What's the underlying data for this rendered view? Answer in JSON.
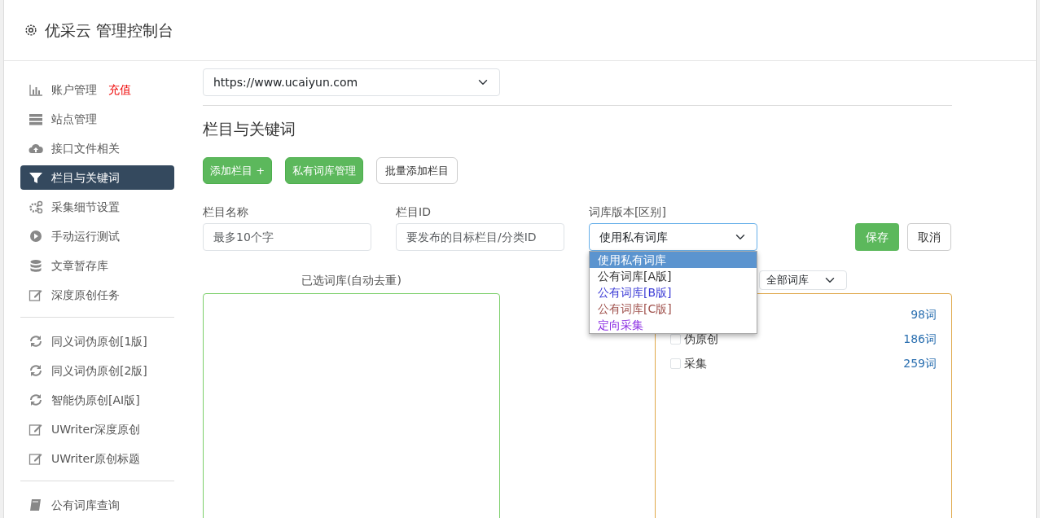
{
  "header": {
    "title": "优采云 管理控制台"
  },
  "sidebar": {
    "groups": [
      {
        "items": [
          {
            "label": "账户管理",
            "badge": "充值",
            "selected": false
          },
          {
            "label": "站点管理",
            "selected": false
          },
          {
            "label": "接口文件相关",
            "selected": false
          },
          {
            "label": "栏目与关键词",
            "selected": true
          },
          {
            "label": "采集细节设置",
            "selected": false
          },
          {
            "label": "手动运行测试",
            "selected": false
          },
          {
            "label": "文章暂存库",
            "selected": false
          },
          {
            "label": "深度原创任务",
            "selected": false
          }
        ]
      },
      {
        "items": [
          {
            "label": "同义词伪原创[1版]",
            "selected": false
          },
          {
            "label": "同义词伪原创[2版]",
            "selected": false
          },
          {
            "label": "智能伪原创[AI版]",
            "selected": false
          },
          {
            "label": "UWriter深度原创",
            "selected": false
          },
          {
            "label": "UWriter原创标题",
            "selected": false
          }
        ]
      },
      {
        "items": [
          {
            "label": "公有词库查询",
            "selected": false
          }
        ]
      }
    ]
  },
  "site_select": {
    "value": "https://www.ucaiyun.com"
  },
  "section_title": "栏目与关键词",
  "buttons": [
    {
      "label": "添加栏目 +",
      "kind": "success"
    },
    {
      "label": "私有词库管理",
      "kind": "success"
    },
    {
      "label": "批量添加栏目",
      "kind": "outline"
    }
  ],
  "form": {
    "fields": [
      {
        "label": "栏目名称",
        "placeholder": "最多10个字",
        "kind": "input"
      },
      {
        "label": "栏目ID",
        "placeholder": "要发布的目标栏目/分类ID",
        "kind": "input"
      },
      {
        "label": "词库版本[区别]",
        "value": "使用私有词库",
        "kind": "select"
      }
    ],
    "save": "保存",
    "cancel": "取消",
    "dropdown": [
      {
        "label": "使用私有词库",
        "selected": true
      },
      {
        "label": "公有词库[A版]",
        "selected": false,
        "color": "#333333"
      },
      {
        "label": "公有词库[B版]",
        "selected": false,
        "color": "#3b3bd6"
      },
      {
        "label": "公有词库[C版]",
        "selected": false,
        "color": "#a0524d"
      },
      {
        "label": "定向采集",
        "selected": false,
        "color": "#8a2be2"
      }
    ]
  },
  "selected_panel": {
    "title": "已选词库(自动去重)"
  },
  "library_filter": {
    "value": "全部词库"
  },
  "library_list": [
    {
      "count": "98词"
    },
    {
      "label": "伪原创",
      "count": "186词",
      "checked": false
    },
    {
      "label": "采集",
      "count": "259词",
      "checked": false
    }
  ]
}
